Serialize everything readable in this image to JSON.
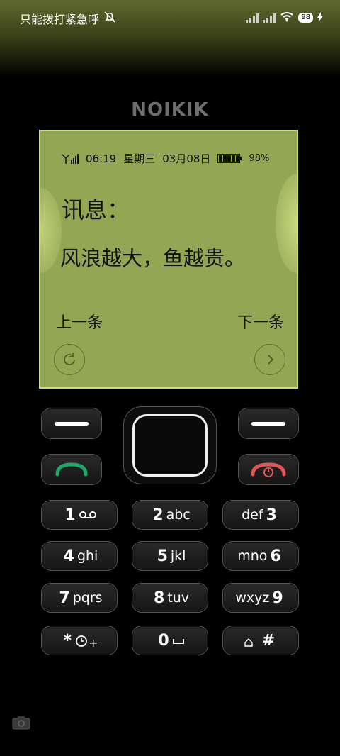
{
  "status_bar": {
    "left_text": "只能拨打紧急呼",
    "battery_level": "98"
  },
  "brand": "NOIKIK",
  "lcd": {
    "time": "06:19",
    "weekday": "星期三",
    "date": "03月08日",
    "battery_percent": "98%",
    "title": "讯息：",
    "message": "风浪越大，鱼越贵。",
    "soft_left": "上一条",
    "soft_right": "下一条"
  },
  "keypad": {
    "k1": {
      "digit": "1",
      "letters": "⌂"
    },
    "k2": {
      "digit": "2",
      "letters": "abc"
    },
    "k3": {
      "digit": "3",
      "letters": "def"
    },
    "k4": {
      "digit": "4",
      "letters": "ghi"
    },
    "k5": {
      "digit": "5",
      "letters": "jkl"
    },
    "k6": {
      "digit": "6",
      "letters": "mno"
    },
    "k7": {
      "digit": "7",
      "letters": "pqrs"
    },
    "k8": {
      "digit": "8",
      "letters": "tuv"
    },
    "k9": {
      "digit": "9",
      "letters": "wxyz"
    },
    "kstar": {
      "symbol": "*",
      "extra": "+"
    },
    "k0": {
      "digit": "0",
      "extra": "␣"
    },
    "khash": {
      "symbol": "#"
    }
  },
  "colors": {
    "lcd_background": "#93a654",
    "lcd_border": "#cfe07a",
    "call_green": "#1ea86a",
    "end_red": "#e05555"
  }
}
